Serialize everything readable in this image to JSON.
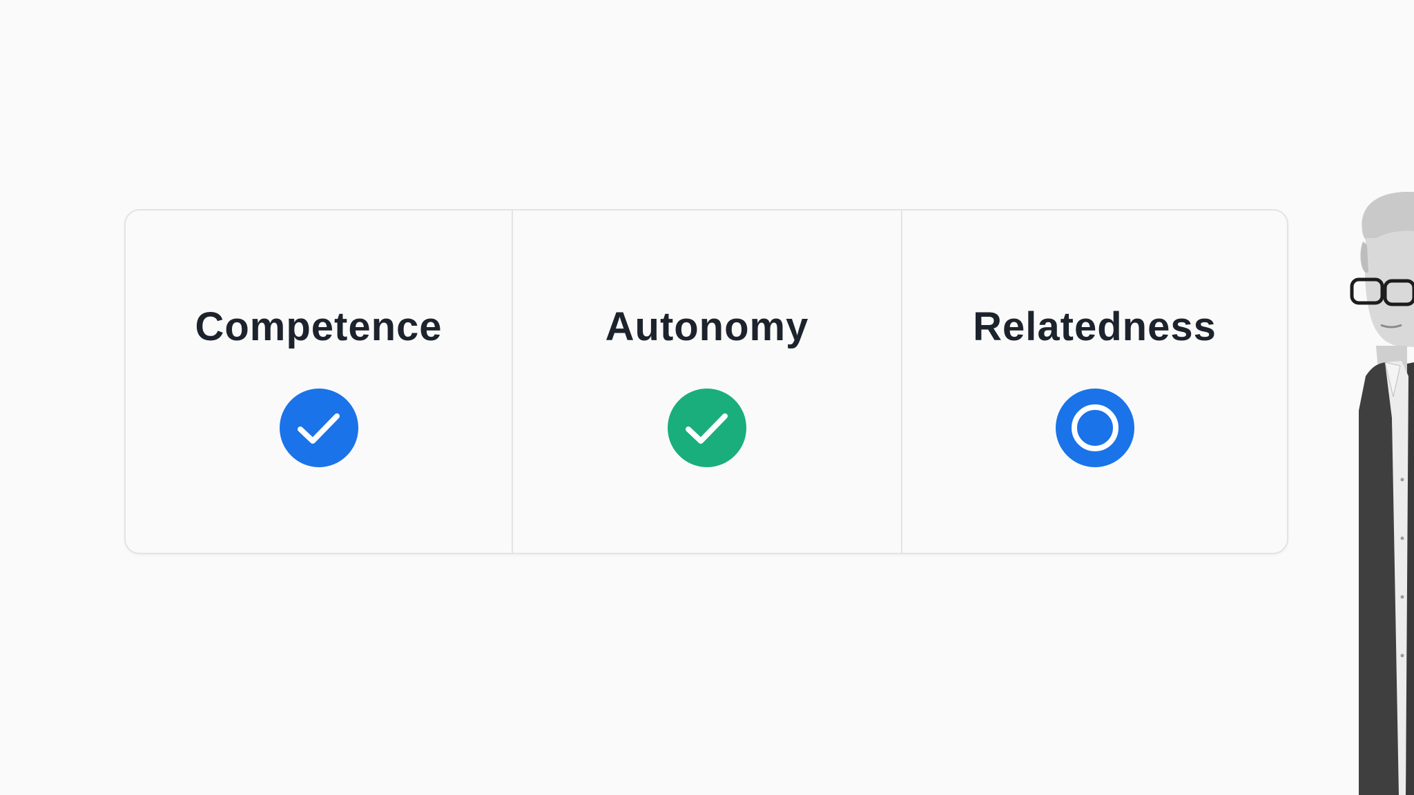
{
  "slide": {
    "cards": [
      {
        "title": "Competence",
        "status": "checked",
        "icon": "check-circle-icon",
        "color": "#1a73e8"
      },
      {
        "title": "Autonomy",
        "status": "checked",
        "icon": "check-circle-icon",
        "color": "#1aae7d"
      },
      {
        "title": "Relatedness",
        "status": "in-progress",
        "icon": "ring-circle-icon",
        "color": "#1a73e8"
      }
    ]
  },
  "colors": {
    "background": "#fafafa",
    "border": "#e2e3e6",
    "text": "#1d232c"
  },
  "presenter": {
    "icon": "presenter-photo",
    "description_visible": false
  }
}
